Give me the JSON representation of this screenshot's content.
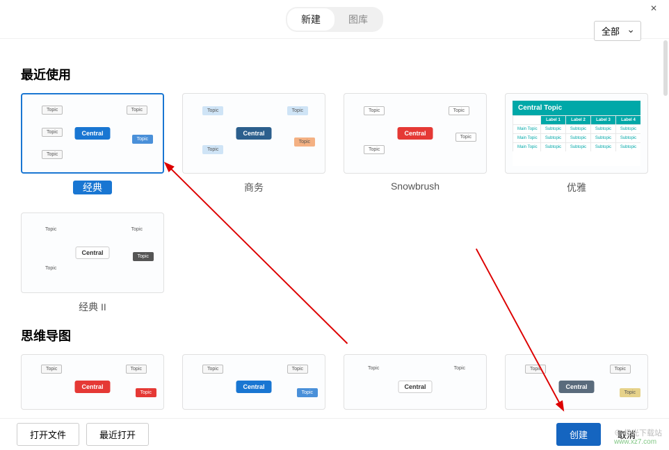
{
  "window": {
    "close_symbol": "✕"
  },
  "tabs": {
    "new": "新建",
    "library": "图库"
  },
  "filter": {
    "selected": "全部"
  },
  "sections": {
    "recent": {
      "title": "最近使用",
      "items": [
        {
          "id": "classic",
          "label": "经典",
          "central_text": "Central",
          "selected": true,
          "style": "blue"
        },
        {
          "id": "business",
          "label": "商务",
          "central_text": "Central",
          "selected": false,
          "style": "dblue"
        },
        {
          "id": "snowbrush",
          "label": "Snowbrush",
          "central_text": "Central",
          "selected": false,
          "style": "red"
        },
        {
          "id": "elegant",
          "label": "优雅",
          "central_text": "Central Topic",
          "selected": false,
          "style": "table"
        },
        {
          "id": "classic2",
          "label": "经典 II",
          "central_text": "Central",
          "selected": false,
          "style": "white"
        }
      ]
    },
    "mindmap": {
      "title": "思维导图",
      "items": [
        {
          "id": "mm1",
          "central_text": "Central",
          "style": "red"
        },
        {
          "id": "mm2",
          "central_text": "Central",
          "style": "blue"
        },
        {
          "id": "mm3",
          "central_text": "Central",
          "style": "white"
        },
        {
          "id": "mm4",
          "central_text": "Central",
          "style": "grey"
        }
      ]
    }
  },
  "thumb_labels": {
    "topic": "Topic",
    "main_topic": "Main Topic",
    "subtopic": "Subtopic",
    "label1": "Label 1",
    "label2": "Label 2",
    "label3": "Label 3",
    "label4": "Label 4"
  },
  "buttons": {
    "open_file": "打开文件",
    "recent_open": "最近打开",
    "create": "创建",
    "cancel": "取消"
  },
  "watermark": {
    "line1": "⊕ 极光下载站",
    "line2": "www.xz7.com"
  }
}
